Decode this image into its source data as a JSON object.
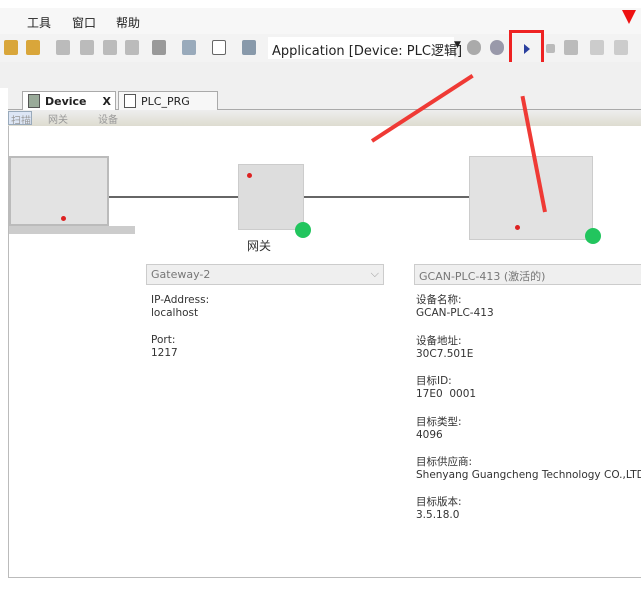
{
  "menu": [
    "工具",
    "窗口",
    "帮助"
  ],
  "toolbar": {
    "application_selector": "Application [Device: PLC逻辑]",
    "run_button_highlighted": true,
    "highlight_color": "#ee2222"
  },
  "tabs": [
    {
      "label": "Device",
      "close": "X",
      "active": true
    },
    {
      "label": "PLC_PRG",
      "active": false
    }
  ],
  "subtabs": [
    "扫描",
    "网关",
    "设备"
  ],
  "gateway": {
    "name": "网关",
    "selector": "Gateway-2",
    "ip_label": "IP-Address:",
    "ip": "localhost",
    "port_label": "Port:",
    "port": "1217",
    "status_color": "#22c55e"
  },
  "device": {
    "selector": "GCAN-PLC-413 (激活的)",
    "status_color": "#22c55e",
    "fields": [
      {
        "label": "设备名称:",
        "value": "GCAN-PLC-413"
      },
      {
        "label": "设备地址:",
        "value": "30C7.501E"
      },
      {
        "label": "目标ID:",
        "value": "17E0  0001"
      },
      {
        "label": "目标类型:",
        "value": "4096"
      },
      {
        "label": "目标供应商:",
        "value": "Shenyang Guangcheng Technology CO.,LTD."
      },
      {
        "label": "目标版本:",
        "value": "3.5.18.0"
      }
    ]
  }
}
